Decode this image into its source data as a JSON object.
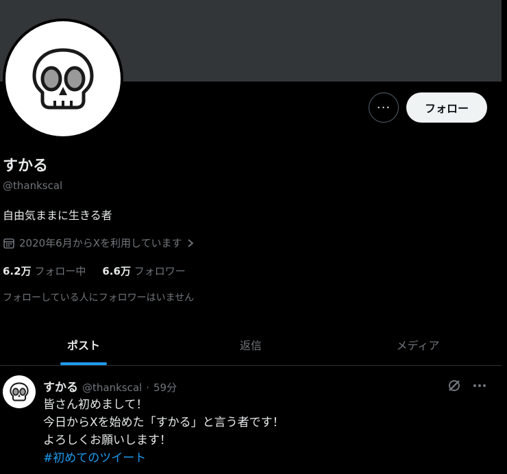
{
  "profile": {
    "display_name": "すかる",
    "handle": "@thankscal",
    "bio": "自由気ままに生きる者",
    "joined": "2020年6月からXを利用しています",
    "following_count": "6.2万",
    "following_label": "フォロー中",
    "followers_count": "6.6万",
    "followers_label": "フォロワー",
    "no_followers_you_know": "フォローしている人にフォロワーはいません"
  },
  "actions": {
    "more_label": "···",
    "follow_label": "フォロー"
  },
  "tabs": [
    {
      "label": "ポスト",
      "active": true
    },
    {
      "label": "返信",
      "active": false
    },
    {
      "label": "メディア",
      "active": false
    }
  ],
  "post": {
    "name": "すかる",
    "handle": "@thankscal",
    "time": "59分",
    "lines": [
      "皆さん初めまして！",
      "今日からXを始めた「すかる」と言う者です！",
      "よろしくお願いします！"
    ],
    "hashtag": "#初めてのツイート"
  },
  "colors": {
    "accent": "#1d9bf0",
    "banner": "#333639",
    "background": "#000000"
  },
  "icons": [
    "skull-avatar-icon",
    "calendar-icon",
    "chevron-right-icon",
    "grok-icon",
    "more-dots-icon"
  ]
}
